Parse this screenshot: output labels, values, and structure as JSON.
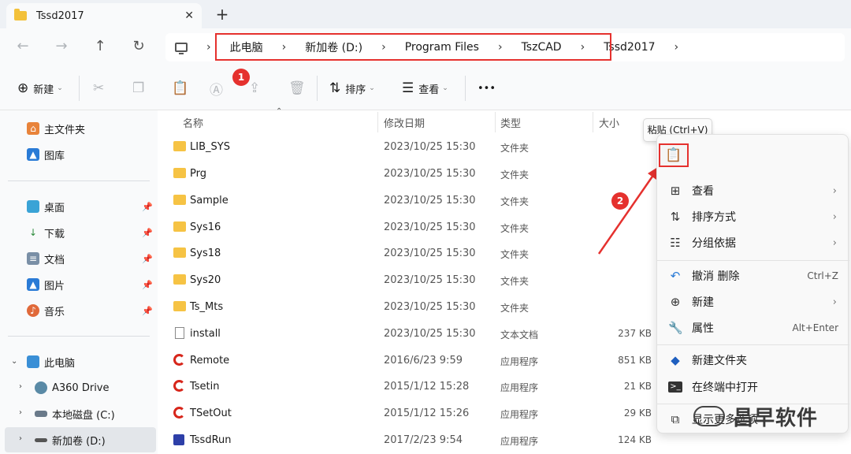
{
  "tab": {
    "title": "Tssd2017",
    "close": "✕",
    "new": "+"
  },
  "nav": {
    "back": "←",
    "forward": "→",
    "up": "↑",
    "refresh": "↻"
  },
  "breadcrumb": [
    "此电脑",
    "新加卷 (D:)",
    "Program Files",
    "TszCAD",
    "Tssd2017"
  ],
  "breadcrumb_sep": "›",
  "toolbar": {
    "new_label": "新建",
    "sort_label": "排序",
    "view_label": "查看",
    "more": "•••",
    "badge1": "1"
  },
  "sidebar": {
    "home": "主文件夹",
    "gallery": "图库",
    "desktop": "桌面",
    "downloads": "下载",
    "documents": "文档",
    "pictures": "图片",
    "music": "音乐",
    "thispc": "此电脑",
    "a360": "A360 Drive",
    "cdrive": "本地磁盘 (C:)",
    "ddrive": "新加卷 (D:)"
  },
  "columns": {
    "name": "名称",
    "date": "修改日期",
    "type": "类型",
    "size": "大小"
  },
  "files": [
    {
      "name": "LIB_SYS",
      "date": "2023/10/25 15:30",
      "type": "文件夹",
      "size": ""
    },
    {
      "name": "Prg",
      "date": "2023/10/25 15:30",
      "type": "文件夹",
      "size": ""
    },
    {
      "name": "Sample",
      "date": "2023/10/25 15:30",
      "type": "文件夹",
      "size": ""
    },
    {
      "name": "Sys16",
      "date": "2023/10/25 15:30",
      "type": "文件夹",
      "size": ""
    },
    {
      "name": "Sys18",
      "date": "2023/10/25 15:30",
      "type": "文件夹",
      "size": ""
    },
    {
      "name": "Sys20",
      "date": "2023/10/25 15:30",
      "type": "文件夹",
      "size": ""
    },
    {
      "name": "Ts_Mts",
      "date": "2023/10/25 15:30",
      "type": "文件夹",
      "size": ""
    },
    {
      "name": "install",
      "date": "2023/10/25 15:30",
      "type": "文本文档",
      "size": "237 KB"
    },
    {
      "name": "Remote",
      "date": "2016/6/23 9:59",
      "type": "应用程序",
      "size": "851 KB"
    },
    {
      "name": "Tsetin",
      "date": "2015/1/12 15:28",
      "type": "应用程序",
      "size": "21 KB"
    },
    {
      "name": "TSetOut",
      "date": "2015/1/12 15:26",
      "type": "应用程序",
      "size": "29 KB"
    },
    {
      "name": "TssdRun",
      "date": "2017/2/23 9:54",
      "type": "应用程序",
      "size": "124 KB"
    }
  ],
  "tooltip": "粘贴 (Ctrl+V)",
  "context_menu": {
    "view": "查看",
    "sort": "排序方式",
    "group": "分组依据",
    "undo": "撤消 删除",
    "undo_shortcut": "Ctrl+Z",
    "new": "新建",
    "properties": "属性",
    "properties_shortcut": "Alt+Enter",
    "new_folder": "新建文件夹",
    "terminal": "在终端中打开",
    "more_options": "显示更多选项",
    "badge2": "2"
  },
  "watermark": "昌早软件",
  "colors": {
    "annotation_red": "#e5312e",
    "folder_yellow": "#f6c344"
  }
}
